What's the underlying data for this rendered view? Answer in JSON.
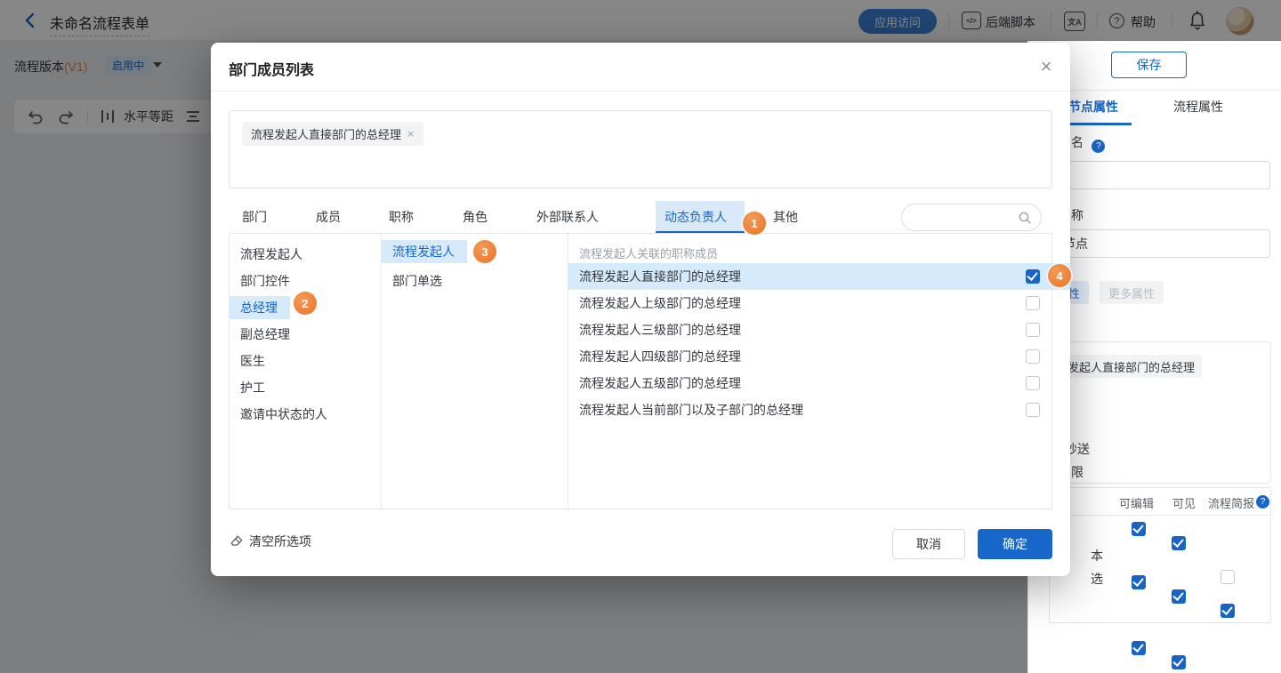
{
  "topbar": {
    "title": "未命名流程表单",
    "app_access": "应用访问",
    "backend_script": "后端脚本",
    "code_glyph": "</>",
    "translate_glyph": "文A",
    "help_glyph": "?",
    "help": "帮助"
  },
  "version_bar": {
    "label": "流程版本",
    "version": "(V1)",
    "status": "启用中"
  },
  "canvas_toolbar": {
    "horizontal_label": "水平等距"
  },
  "panel": {
    "save": "保存",
    "tabs": [
      {
        "label": "节点属性"
      },
      {
        "label": "流程属性"
      }
    ],
    "field1_label_fragment": "名",
    "field1_help": "?",
    "field2_label_fragment": "称",
    "field2_value_fragment": "节点",
    "chip_selected_fragment": "属性",
    "chip_more": "更多属性",
    "tag_fragment": "发起人直接部门的总经理",
    "cc_fragment": "抄送",
    "perm_fragment": "限",
    "perm_help": "?",
    "table": {
      "headers": [
        "可编辑",
        "可见",
        "流程简报"
      ],
      "rows": [
        {
          "label": "",
          "c1": true,
          "c2": true,
          "c3": null
        },
        {
          "label": "本",
          "c1": true,
          "c2": true,
          "c3": true
        },
        {
          "label": "选",
          "c1": true,
          "c2": true,
          "c3": false
        }
      ]
    }
  },
  "modal": {
    "title": "部门成员列表",
    "close_glyph": "×",
    "selected_tag": "流程发起人直接部门的总经理",
    "tag_close_glyph": "×",
    "tabs": [
      {
        "label": "部门"
      },
      {
        "label": "成员"
      },
      {
        "label": "职称"
      },
      {
        "label": "角色"
      },
      {
        "label": "外部联系人"
      },
      {
        "label": "动态负责人"
      },
      {
        "label": "其他"
      }
    ],
    "col1": [
      {
        "label": "流程发起人"
      },
      {
        "label": "部门控件"
      },
      {
        "label": "总经理"
      },
      {
        "label": "副总经理"
      },
      {
        "label": "医生"
      },
      {
        "label": "护工"
      },
      {
        "label": "邀请中状态的人"
      }
    ],
    "col2": [
      {
        "label": "流程发起人"
      },
      {
        "label": "部门单选"
      }
    ],
    "col3_header": "流程发起人关联的职称成员",
    "col3": [
      {
        "label": "流程发起人直接部门的总经理",
        "checked": true
      },
      {
        "label": "流程发起人上级部门的总经理",
        "checked": false
      },
      {
        "label": "流程发起人三级部门的总经理",
        "checked": false
      },
      {
        "label": "流程发起人四级部门的总经理",
        "checked": false
      },
      {
        "label": "流程发起人五级部门的总经理",
        "checked": false
      },
      {
        "label": "流程发起人当前部门以及子部门的总经理",
        "checked": false
      }
    ],
    "clear": "清空所选项",
    "cancel": "取消",
    "confirm": "确定"
  },
  "badges": [
    {
      "n": "1"
    },
    {
      "n": "2"
    },
    {
      "n": "3"
    },
    {
      "n": "4"
    }
  ],
  "colors": {
    "primary": "#1766C9",
    "badge_orange": "#EE7D31",
    "selected_blue_bg": "#D7EAF9"
  }
}
